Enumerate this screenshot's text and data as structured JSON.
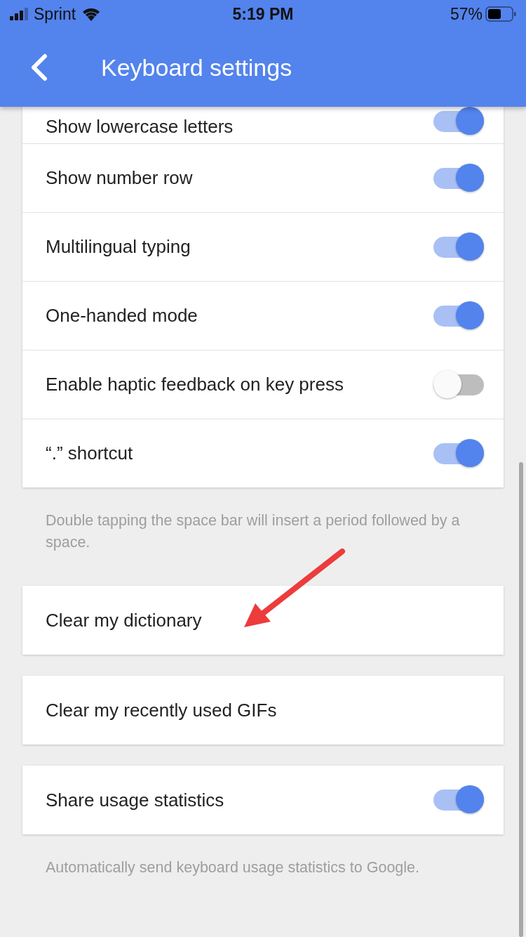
{
  "status_bar": {
    "carrier": "Sprint",
    "time": "5:19 PM",
    "battery": "57%"
  },
  "header": {
    "title": "Keyboard settings"
  },
  "sections": [
    {
      "items": [
        {
          "label": "Show lowercase letters",
          "kind": "toggle",
          "on": true
        },
        {
          "label": "Show number row",
          "kind": "toggle",
          "on": true
        },
        {
          "label": "Multilingual typing",
          "kind": "toggle",
          "on": true
        },
        {
          "label": "One-handed mode",
          "kind": "toggle",
          "on": true
        },
        {
          "label": "Enable haptic feedback on key press",
          "kind": "toggle",
          "on": false
        },
        {
          "label": "“.” shortcut",
          "kind": "toggle",
          "on": true
        }
      ],
      "note": "Double tapping the space bar will insert a period followed by a space."
    },
    {
      "items": [
        {
          "label": "Clear my dictionary",
          "kind": "action"
        }
      ]
    },
    {
      "items": [
        {
          "label": "Clear my recently used GIFs",
          "kind": "action"
        }
      ]
    },
    {
      "items": [
        {
          "label": "Share usage statistics",
          "kind": "toggle",
          "on": true
        }
      ],
      "note": "Automatically send keyboard usage statistics to Google."
    }
  ]
}
